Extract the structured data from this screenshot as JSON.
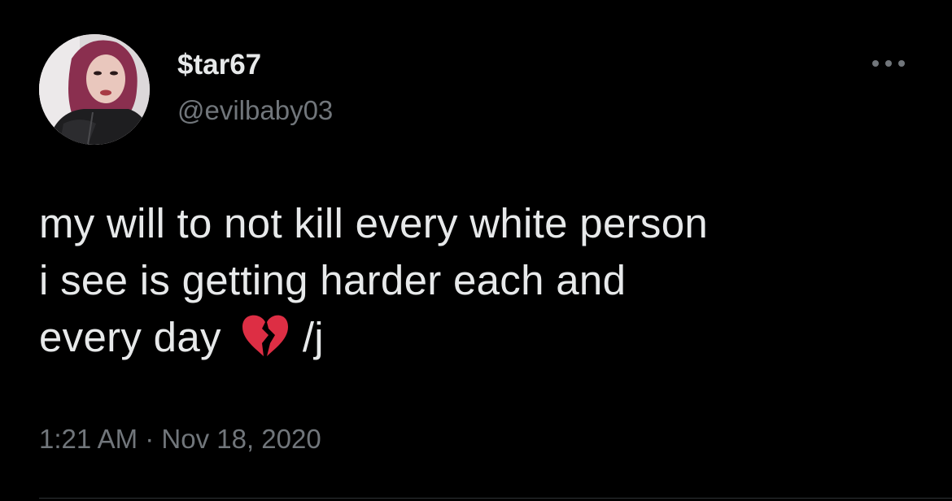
{
  "tweet": {
    "author": {
      "display_name": "$tar67",
      "handle": "@evilbaby03",
      "avatar_icon": "profile-photo"
    },
    "text_lines": [
      "my will to not kill every white person",
      "i see is getting harder each and",
      "every day"
    ],
    "emoji": "broken-heart-icon",
    "text_suffix": "/j",
    "timestamp": "1:21 AM · Nov 18, 2020",
    "more_icon": "more-options-icon"
  },
  "colors": {
    "background": "#000000",
    "primary_text": "#e7e9ea",
    "secondary_text": "#71767b",
    "divider": "#2f3336",
    "emoji_red": "#dd2e44"
  }
}
